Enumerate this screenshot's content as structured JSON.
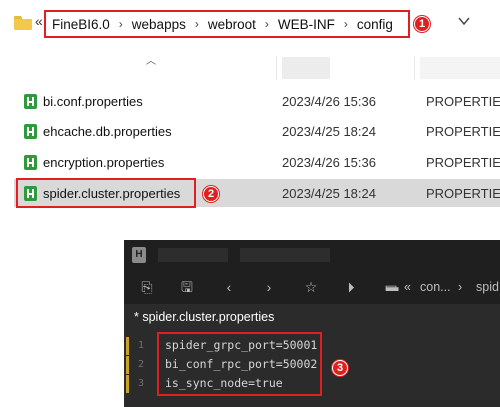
{
  "address_bar": {
    "overflow_glyph": "«",
    "crumbs": [
      "FineBI6.0",
      "webapps",
      "webroot",
      "WEB-INF",
      "config"
    ],
    "separator": "›"
  },
  "callouts": [
    "1",
    "2",
    "3"
  ],
  "files": [
    {
      "name": "bi.conf.properties",
      "modified": "2023/4/26 15:36",
      "type": "PROPERTIES",
      "selected": false
    },
    {
      "name": "ehcache.db.properties",
      "modified": "2023/4/25 18:24",
      "type": "PROPERTIES",
      "selected": false
    },
    {
      "name": "encryption.properties",
      "modified": "2023/4/26 15:36",
      "type": "PROPERTIES",
      "selected": false
    },
    {
      "name": "spider.cluster.properties",
      "modified": "2023/4/25 18:24",
      "type": "PROPERTIES",
      "selected": true
    }
  ],
  "editor": {
    "toolbar_path": [
      "«",
      "con...",
      "›",
      "spid"
    ],
    "tab_label": "* spider.cluster.properties",
    "lines": [
      {
        "n": "1",
        "text": "spider_grpc_port=50001"
      },
      {
        "n": "2",
        "text": "bi_conf_rpc_port=50002"
      },
      {
        "n": "3",
        "text": "is_sync_node=true"
      }
    ]
  },
  "colors": {
    "highlight_red": "#e02020",
    "file_icon_green": "#2e9a3c",
    "editor_bg": "#2b2b2b",
    "selected_row": "#d9d9d9"
  }
}
